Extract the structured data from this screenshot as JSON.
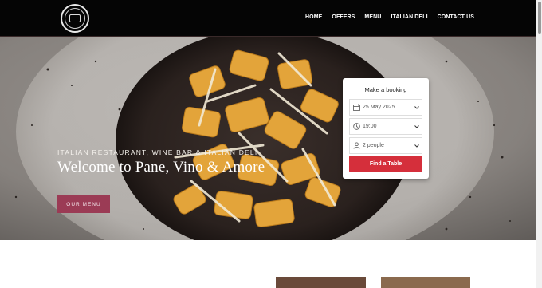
{
  "header": {
    "nav": [
      "HOME",
      "OFFERS",
      "MENU",
      "ITALIAN DELI",
      "CONTACT US"
    ]
  },
  "hero": {
    "tagline": "ITALIAN RESTAURANT, WINE BAR & ITALIAN DELI",
    "title": "Welcome to Pane, Vino & Amore",
    "menu_button": "OUR MENU"
  },
  "booking": {
    "title": "Make a booking",
    "date": "25 May 2025",
    "time": "19:00",
    "guests": "2 people",
    "submit": "Find a Table"
  },
  "colors": {
    "header_bg": "#050505",
    "menu_button": "#9b3b55",
    "find_button": "#d52f3b"
  },
  "icons": [
    "calendar-icon",
    "clock-icon",
    "person-icon",
    "chevron-down-icon"
  ]
}
